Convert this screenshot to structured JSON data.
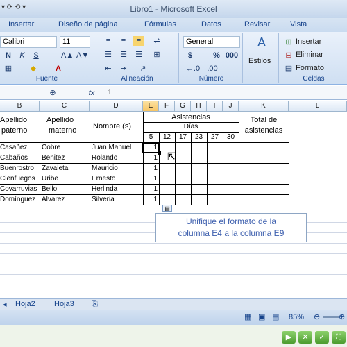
{
  "window": {
    "title": "Libro1 - Microsoft Excel"
  },
  "menu_tabs": [
    "Insertar",
    "Diseño de página",
    "Fórmulas",
    "Datos",
    "Revisar",
    "Vista"
  ],
  "ribbon": {
    "font_name": "Calibri",
    "font_size": "11",
    "fuente_label": "Fuente",
    "alineacion_label": "Alineación",
    "number_format": "General",
    "numero_label": "Número",
    "percent": "%",
    "thousands": "000",
    "estilos_label": "Estilos",
    "celdas_label": "Celdas",
    "insertar_label": "Insertar",
    "eliminar_label": "Eliminar",
    "formato_label": "Formato"
  },
  "formula_bar": {
    "fx": "fx",
    "value": "1"
  },
  "columns": [
    "B",
    "C",
    "D",
    "E",
    "F",
    "G",
    "H",
    "I",
    "J",
    "K",
    "L"
  ],
  "headers": {
    "apellido_paterno_1": "Apellido",
    "apellido_paterno_2": "paterno",
    "apellido_materno_1": "Apellido",
    "apellido_materno_2": "materno",
    "nombres": "Nombre (s)",
    "asistencias": "Asistencias",
    "dias": "Días",
    "total_1": "Total de",
    "total_2": "asistencias"
  },
  "days": [
    "5",
    "12",
    "17",
    "23",
    "27",
    "30"
  ],
  "rows": [
    {
      "paterno": "Casañez",
      "materno": "Cobre",
      "nombre": "Juan Manuel",
      "e": "1"
    },
    {
      "paterno": "Cabaños",
      "materno": "Benitez",
      "nombre": "Rolando",
      "e": "1"
    },
    {
      "paterno": "Buenrostro",
      "materno": "Zavaleta",
      "nombre": "Mauricio",
      "e": "1"
    },
    {
      "paterno": "Cienfuegos",
      "materno": "Uribe",
      "nombre": "Ernesto",
      "e": "1"
    },
    {
      "paterno": "Covarruvias",
      "materno": "Bello",
      "nombre": "Herlinda",
      "e": "1"
    },
    {
      "paterno": "Domínguez",
      "materno": "Álvarez",
      "nombre": "Silveria",
      "e": "1"
    }
  ],
  "callout": {
    "line1": "Unifique el formato de la",
    "line2": "columna E4 a la columna E9"
  },
  "sheets": [
    "Hoja2",
    "Hoja3"
  ],
  "status": {
    "zoom": "85%"
  }
}
